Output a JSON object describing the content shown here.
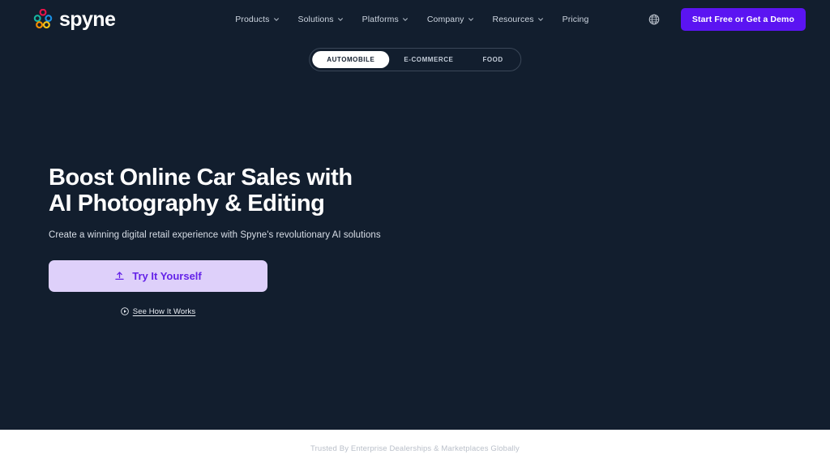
{
  "brand": {
    "name": "spyne",
    "logo_icon": "spyne-flower-logo",
    "logo_colors": {
      "top": "#e8134a",
      "left": "#17b5a0",
      "right": "#1a8fe3",
      "bottom_left": "#f79000",
      "bottom_right": "#f5c518"
    }
  },
  "header": {
    "nav": [
      {
        "label": "Products",
        "has_dropdown": true
      },
      {
        "label": "Solutions",
        "has_dropdown": true
      },
      {
        "label": "Platforms",
        "has_dropdown": true
      },
      {
        "label": "Company",
        "has_dropdown": true
      },
      {
        "label": "Resources",
        "has_dropdown": true
      },
      {
        "label": "Pricing",
        "has_dropdown": false
      }
    ],
    "language_icon": "globe-icon",
    "cta_label": "Start Free or Get a Demo",
    "cta_color": "#5b14f2"
  },
  "segmented_tabs": {
    "items": [
      {
        "label": "AUTOMOBILE",
        "active": true
      },
      {
        "label": "E-COMMERCE",
        "active": false
      },
      {
        "label": "FOOD",
        "active": false
      }
    ]
  },
  "hero": {
    "headline": "Boost Online Car Sales with AI Photography & Editing",
    "subheadline": "Create a winning digital retail experience with Spyne's revolutionary AI solutions",
    "primary_button": {
      "label": "Try It Yourself",
      "icon": "upload-icon",
      "background": "#ded0fa",
      "text_color": "#6422e8"
    },
    "secondary_link": {
      "label": "See How It Works",
      "icon": "play-circle-icon"
    },
    "background": "#121e2e"
  },
  "footer": {
    "trusted_text": "Trusted By Enterprise Dealerships & Marketplaces Globally"
  }
}
